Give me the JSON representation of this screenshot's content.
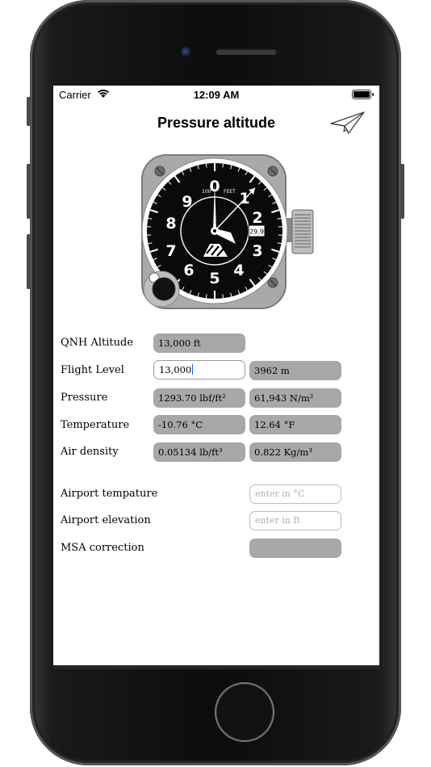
{
  "status_bar": {
    "carrier": "Carrier",
    "time": "12:09 AM"
  },
  "nav": {
    "title": "Pressure altitude",
    "share_icon": "paper-plane-icon"
  },
  "altimeter": {
    "dial_numbers": [
      "0",
      "1",
      "2",
      "3",
      "4",
      "5",
      "6",
      "7",
      "8",
      "9"
    ],
    "label_100": "100",
    "label_feet": "FEET",
    "kollsman_setting": "29.9"
  },
  "fields": {
    "qnh_altitude": {
      "label": "QNH Altitude",
      "value": "13,000 ft"
    },
    "flight_level": {
      "label": "Flight Level",
      "value": "13,000",
      "value_m": "3962 m"
    },
    "pressure": {
      "label": "Pressure",
      "value_imperial": "1293.70 lbf/ft²",
      "value_metric": "61,943 N/m²"
    },
    "temperature": {
      "label": "Temperature",
      "value_c": "-10.76 °C",
      "value_f": "12.64 °F"
    },
    "air_density": {
      "label": "Air density",
      "value_imperial": "0.05134 lb/ft³",
      "value_metric": "0.822 Kg/m³"
    },
    "airport_temperature": {
      "label": "Airport tempature",
      "placeholder": "enter in °C"
    },
    "airport_elevation": {
      "label": "Airport elevation",
      "placeholder": "enter in ft"
    },
    "msa_correction": {
      "label": "MSA correction",
      "value": ""
    }
  },
  "colors": {
    "field_fill": "#a8a8a8",
    "caret": "#1a5cff",
    "instrument_body": "#a9a9a9"
  }
}
